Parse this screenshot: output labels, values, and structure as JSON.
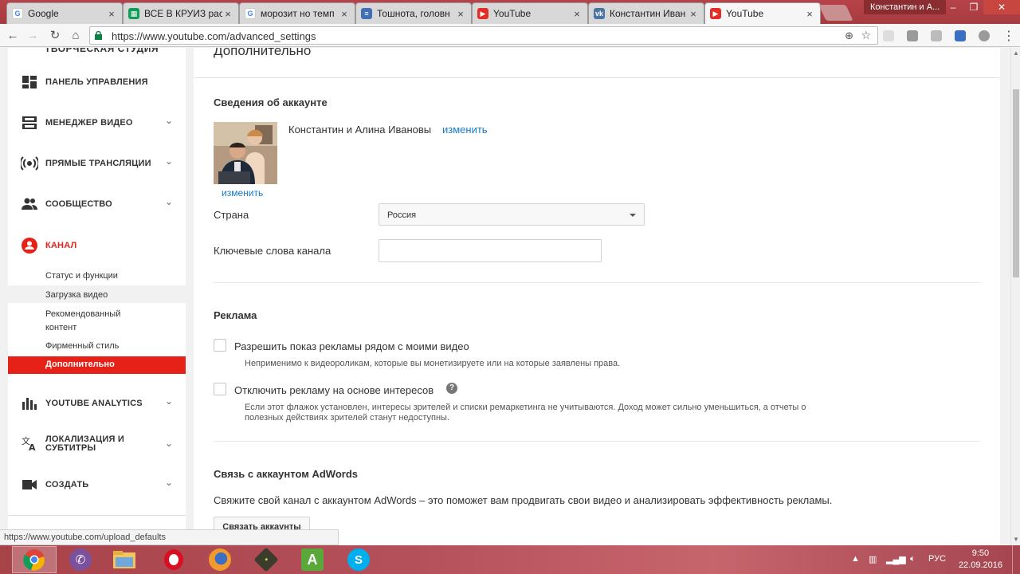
{
  "browser": {
    "tabs": [
      {
        "title": "Google",
        "icon": "google-favicon",
        "active": false
      },
      {
        "title": "ВСЕ В КРУИЗ рас",
        "icon": "sheets-favicon",
        "active": false
      },
      {
        "title": "морозит но темп",
        "icon": "google-favicon",
        "active": false
      },
      {
        "title": "Тошнота, головн",
        "icon": "doc-favicon",
        "active": false
      },
      {
        "title": "YouTube",
        "icon": "youtube-favicon",
        "active": false
      },
      {
        "title": "Константин Иван",
        "icon": "vk-favicon",
        "active": false
      },
      {
        "title": "YouTube",
        "icon": "youtube-favicon",
        "active": true
      }
    ],
    "window_user": "Константин и А...",
    "url": "https://www.youtube.com/advanced_settings",
    "status_url": "https://www.youtube.com/upload_defaults"
  },
  "sidebar": {
    "studio_label": "ТВОРЧЕСКАЯ СТУДИЯ",
    "items": [
      {
        "label": "ПАНЕЛЬ УПРАВЛЕНИЯ",
        "icon": "dashboard-icon"
      },
      {
        "label": "МЕНЕДЖЕР ВИДЕО",
        "icon": "video-manager-icon"
      },
      {
        "label": "ПРЯМЫЕ ТРАНСЛЯЦИИ",
        "icon": "live-broadcast-icon"
      },
      {
        "label": "СООБЩЕСТВО",
        "icon": "community-icon"
      },
      {
        "label": "КАНАЛ",
        "icon": "channel-icon"
      },
      {
        "label": "YOUTUBE ANALYTICS",
        "icon": "analytics-icon"
      },
      {
        "label": "ЛОКАЛИЗАЦИЯ И\nСУБТИТРЫ",
        "icon": "translate-icon"
      },
      {
        "label": "СОЗДАТЬ",
        "icon": "create-video-icon"
      }
    ],
    "channel_subitems": [
      "Статус и функции",
      "Загрузка видео",
      "Рекомендованный\nконтент",
      "Фирменный стиль",
      "Дополнительно"
    ],
    "accent_color": "#e62117"
  },
  "main": {
    "title": "Дополнительно",
    "account": {
      "heading": "Сведения об аккаунте",
      "name": "Константин и Алина Ивановы",
      "change_link": "изменить",
      "avatar_change_link": "изменить",
      "country_label": "Страна",
      "country_value": "Россия",
      "keywords_label": "Ключевые слова канала",
      "keywords_value": ""
    },
    "ads": {
      "heading": "Реклама",
      "option1_label": "Разрешить показ рекламы рядом с моими видео",
      "option1_checked": false,
      "option1_note": "Неприменимо к видеороликам, которые вы монетизируете или на которые заявлены права.",
      "option2_label": "Отключить рекламу на основе интересов",
      "option2_checked": false,
      "option2_note": "Если этот флажок установлен, интересы зрителей и списки ремаркетинга не учитываются. Доход может сильно уменьшиться, а отчеты о полезных действиях зрителей станут недоступны."
    },
    "adwords": {
      "heading": "Связь с аккаунтом AdWords",
      "description": "Свяжите свой канал с аккаунтом AdWords – это поможет вам продвигать свои видео и анализировать эффективность рекламы.",
      "button": "Связать аккаунты"
    },
    "link_color": "#167ac6"
  },
  "taskbar": {
    "apps": [
      "chrome-icon",
      "viber-icon",
      "file-explorer-icon",
      "opera-icon",
      "firefox-icon",
      "app-icon",
      "android-icon",
      "skype-icon"
    ],
    "language": "РУС",
    "time": "9:50",
    "date": "22.09.2016"
  }
}
